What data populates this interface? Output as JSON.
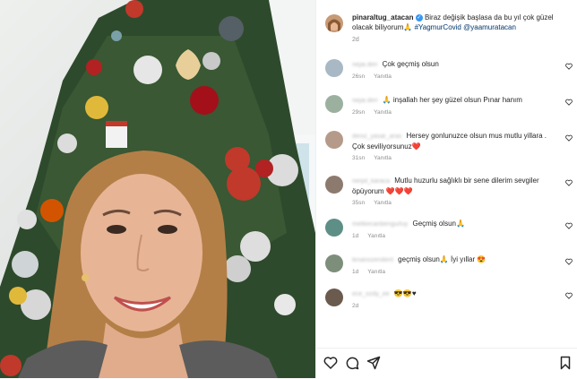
{
  "post": {
    "username": "pinaraltug_atacan",
    "caption": "Biraz değişik başlasa da bu yıl çok güzel olacak biliyorum🙏",
    "hashtag": "#YagmurCovid",
    "mention": "@yaamuratacan",
    "time": "2d"
  },
  "comments": [
    {
      "user": "nejai.deri",
      "text": "Çok geçmiş olsun",
      "time": "26sn",
      "reply": "Yanıtla"
    },
    {
      "user": "nejai.deri",
      "text": "🙏 inşallah her şey güzel olsun Pınar hanım",
      "time": "29sn",
      "reply": "Yanıtla"
    },
    {
      "user": "deniz_yasar_aras",
      "text": "Hersey gonlunuzce olsun mus mutlu yillara . Çok seviliyorsunuz❤️",
      "time": "31sn",
      "reply": "Yanıtla"
    },
    {
      "user": "nerpil_karaca",
      "text": "Mutlu huzurlu sağlıklı bir sene dilerim sevgiler öpüyorum ❤️❤️❤️",
      "time": "35sn",
      "reply": "Yanıtla"
    },
    {
      "user": "melikecanbengurluy",
      "text": "Geçmiş olsun🙏",
      "time": "1d",
      "reply": "Yanıtla"
    },
    {
      "user": "lenanozendent",
      "text": "geçmiş olsun🙏 İyi yıllar 😍",
      "time": "1d",
      "reply": "Yanıtla"
    },
    {
      "user": "ece_ozdy_ee",
      "text": "😎😎♥",
      "time": "2d",
      "reply": ""
    }
  ],
  "icons": [
    "heart-icon",
    "comment-icon",
    "share-icon",
    "bookmark-icon"
  ],
  "colors": {
    "link": "#00376b",
    "muted": "#8e8e8e",
    "verified": "#3897f0"
  }
}
